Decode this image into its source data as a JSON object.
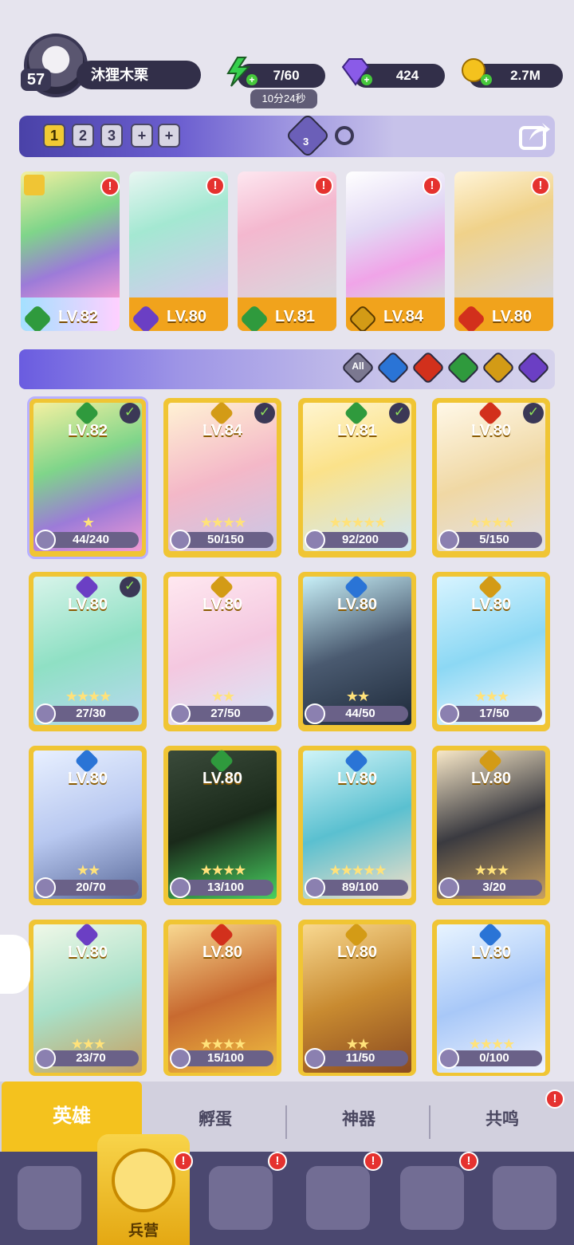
{
  "player": {
    "level": "57",
    "name": "沐狸木栗"
  },
  "resources": {
    "energy": "7/60",
    "energy_timer": "10分24秒",
    "gems": "424",
    "gold": "2.7M"
  },
  "team": {
    "slots": [
      "1",
      "2",
      "3",
      "+",
      "+"
    ],
    "active_slot": "1",
    "share_icon": "share-icon",
    "view_count": "3"
  },
  "team_heroes": [
    {
      "level": "LV.82",
      "element": "nature",
      "alert": "!"
    },
    {
      "level": "LV.80",
      "element": "dark",
      "alert": "!"
    },
    {
      "level": "LV.81",
      "element": "nature",
      "alert": "!"
    },
    {
      "level": "LV.84",
      "element": "light",
      "alert": "!"
    },
    {
      "level": "LV.80",
      "element": "fire",
      "alert": "!"
    }
  ],
  "filters": {
    "all_label": "All",
    "elements": [
      "water",
      "fire",
      "nature",
      "light",
      "dark"
    ]
  },
  "heroes": [
    {
      "level": "LV.82",
      "fragments": "44/240",
      "checked": true
    },
    {
      "level": "LV.84",
      "fragments": "50/150",
      "checked": true
    },
    {
      "level": "LV.81",
      "fragments": "92/200",
      "checked": true
    },
    {
      "level": "LV.80",
      "fragments": "5/150",
      "checked": true
    },
    {
      "level": "LV.80",
      "fragments": "27/30",
      "checked": true
    },
    {
      "level": "LV.80",
      "fragments": "27/50",
      "checked": false
    },
    {
      "level": "LV.80",
      "fragments": "44/50",
      "checked": false
    },
    {
      "level": "LV.80",
      "fragments": "17/50",
      "checked": false
    },
    {
      "level": "LV.80",
      "fragments": "20/70",
      "checked": false
    },
    {
      "level": "LV.80",
      "fragments": "13/100",
      "checked": false
    },
    {
      "level": "LV.80",
      "fragments": "89/100",
      "checked": false
    },
    {
      "level": "LV.80",
      "fragments": "3/20",
      "checked": false
    },
    {
      "level": "LV.80",
      "fragments": "23/70",
      "checked": false
    },
    {
      "level": "LV.80",
      "fragments": "15/100",
      "checked": false
    },
    {
      "level": "LV.80",
      "fragments": "11/50",
      "checked": false
    },
    {
      "level": "LV.80",
      "fragments": "0/100",
      "checked": false
    }
  ],
  "tabs": [
    {
      "label": "英雄"
    },
    {
      "label": "孵蛋"
    },
    {
      "label": "神器"
    },
    {
      "label": "共鸣",
      "alert": "!"
    }
  ],
  "nav": {
    "selected_label": "兵营",
    "alert": "!"
  },
  "colors": {
    "accent": "#f4c21e",
    "panel": "#322f49",
    "nature": "#2f9a3d",
    "dark": "#6b3fc4",
    "light": "#d39b16",
    "fire": "#d2301c",
    "water": "#2a74d6"
  }
}
